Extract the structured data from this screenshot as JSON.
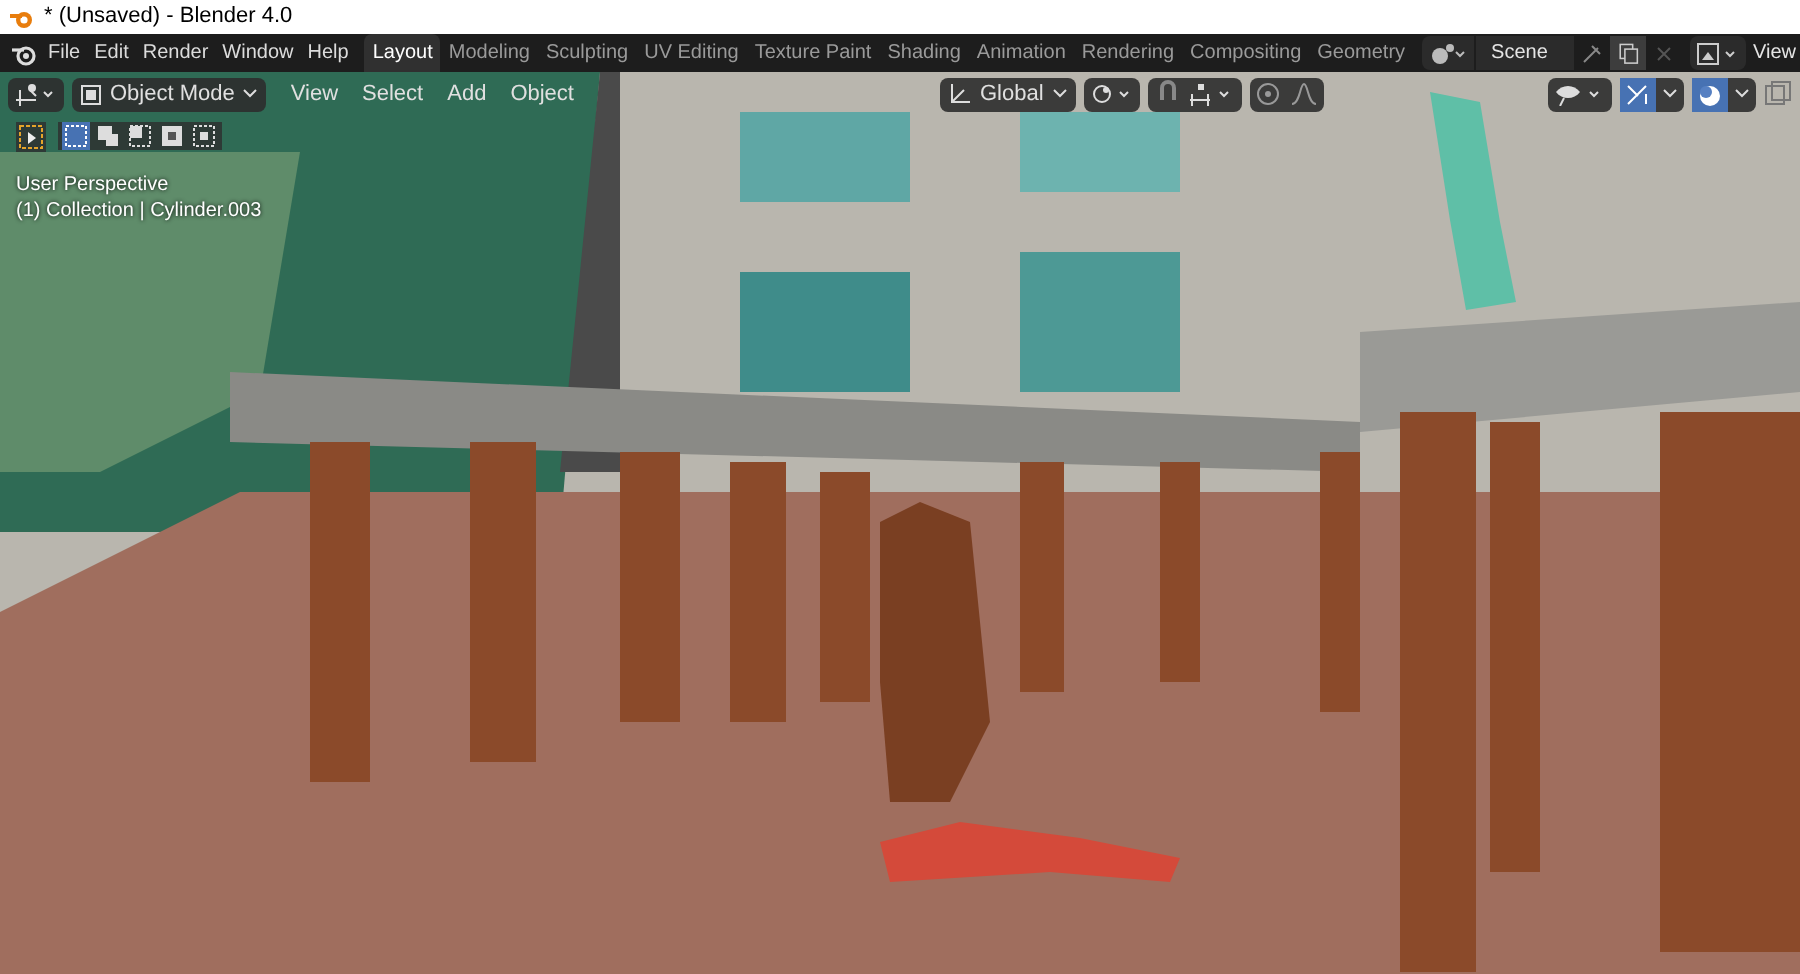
{
  "window": {
    "title": "* (Unsaved) - Blender 4.0"
  },
  "menu": [
    "File",
    "Edit",
    "Render",
    "Window",
    "Help"
  ],
  "workspaces": [
    {
      "label": "Layout",
      "selected": true
    },
    {
      "label": "Modeling",
      "selected": false
    },
    {
      "label": "Sculpting",
      "selected": false
    },
    {
      "label": "UV Editing",
      "selected": false
    },
    {
      "label": "Texture Paint",
      "selected": false
    },
    {
      "label": "Shading",
      "selected": false
    },
    {
      "label": "Animation",
      "selected": false
    },
    {
      "label": "Rendering",
      "selected": false
    },
    {
      "label": "Compositing",
      "selected": false
    },
    {
      "label": "Geometry",
      "selected": false
    }
  ],
  "scene": {
    "name": "Scene"
  },
  "view_layer": {
    "name": "View"
  },
  "viewport_header": {
    "mode": "Object Mode",
    "menus": [
      "View",
      "Select",
      "Add",
      "Object"
    ],
    "orientation": "Global",
    "snap_on": false,
    "gizmos_on": true,
    "overlays_on": true
  },
  "select_modes": [
    {
      "selected": true
    },
    {
      "selected": false
    },
    {
      "selected": false
    },
    {
      "selected": false
    },
    {
      "selected": false
    }
  ],
  "viewport_info": {
    "perspective": "User Perspective",
    "object": "(1) Collection | Cylinder.003"
  }
}
